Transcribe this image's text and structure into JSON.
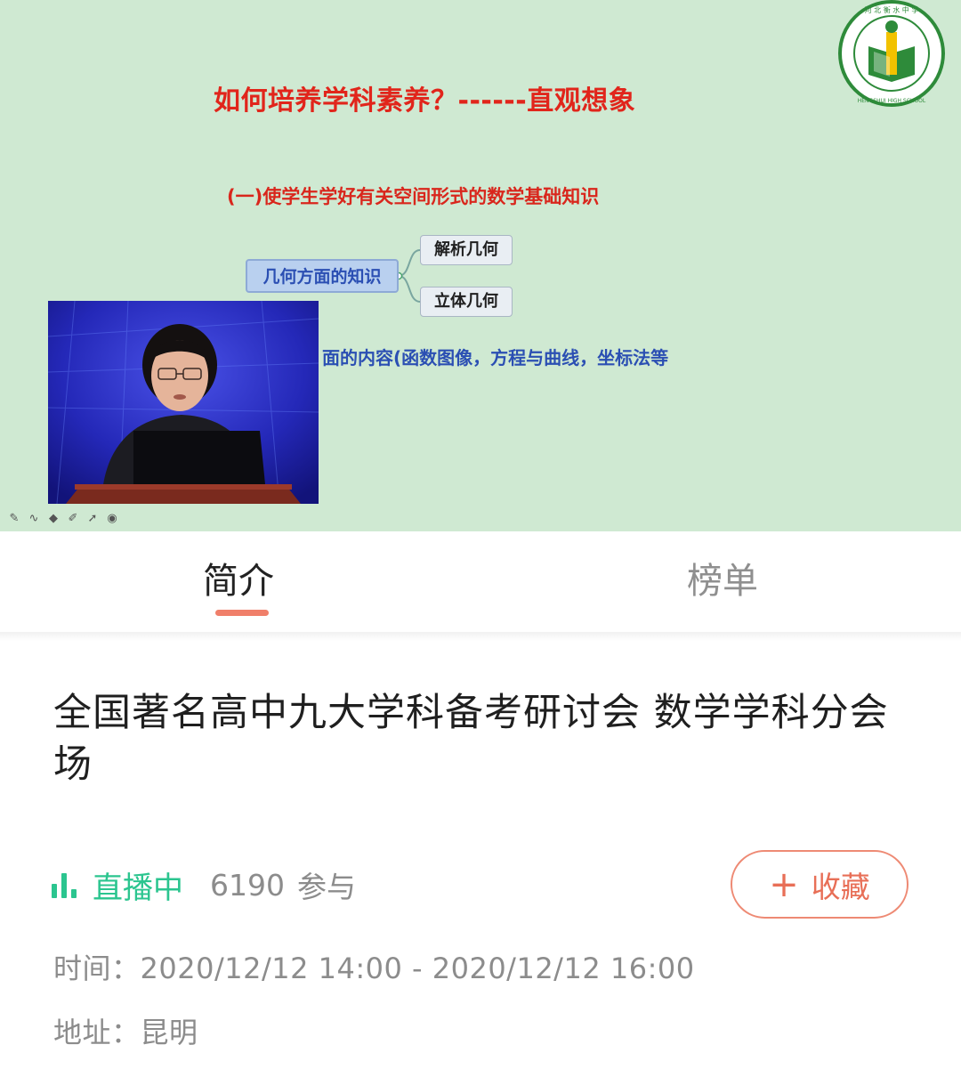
{
  "video": {
    "slide": {
      "title": "如何培养学科素养？------直观想象",
      "subtitle": "(一)使学生学好有关空间形式的数学基础知识",
      "mindmap": {
        "root": "几何方面的知识",
        "children": [
          "解析几何",
          "立体几何"
        ]
      },
      "line3": "面的内容(函数图像，方程与曲线，坐标法等"
    },
    "logo_text": "河北衡水中学 HENGSHUI HIGH SCHOOL HEBEI",
    "toolbar_icons": [
      "pen-icon",
      "curve-icon",
      "eraser-icon",
      "highlighter-icon",
      "pointer-icon",
      "record-icon"
    ]
  },
  "tabs": [
    {
      "label": "简介",
      "active": true
    },
    {
      "label": "榜单",
      "active": false
    }
  ],
  "event": {
    "title": "全国著名高中九大学科备考研讨会 数学学科分会场",
    "status": "直播中",
    "participants": "6190",
    "participants_suffix": "参与",
    "favorite_label": "收藏",
    "time_label": "时间：",
    "time_value": "2020/12/12 14:00 - 2020/12/12 16:00",
    "address_label": "地址：",
    "address_value": "昆明"
  },
  "colors": {
    "slide_bg": "#cfe9d2",
    "live_green": "#2bc58f",
    "accent_orange": "#e86f57",
    "slide_red": "#e1251b",
    "slide_blue": "#2b4fb3"
  }
}
